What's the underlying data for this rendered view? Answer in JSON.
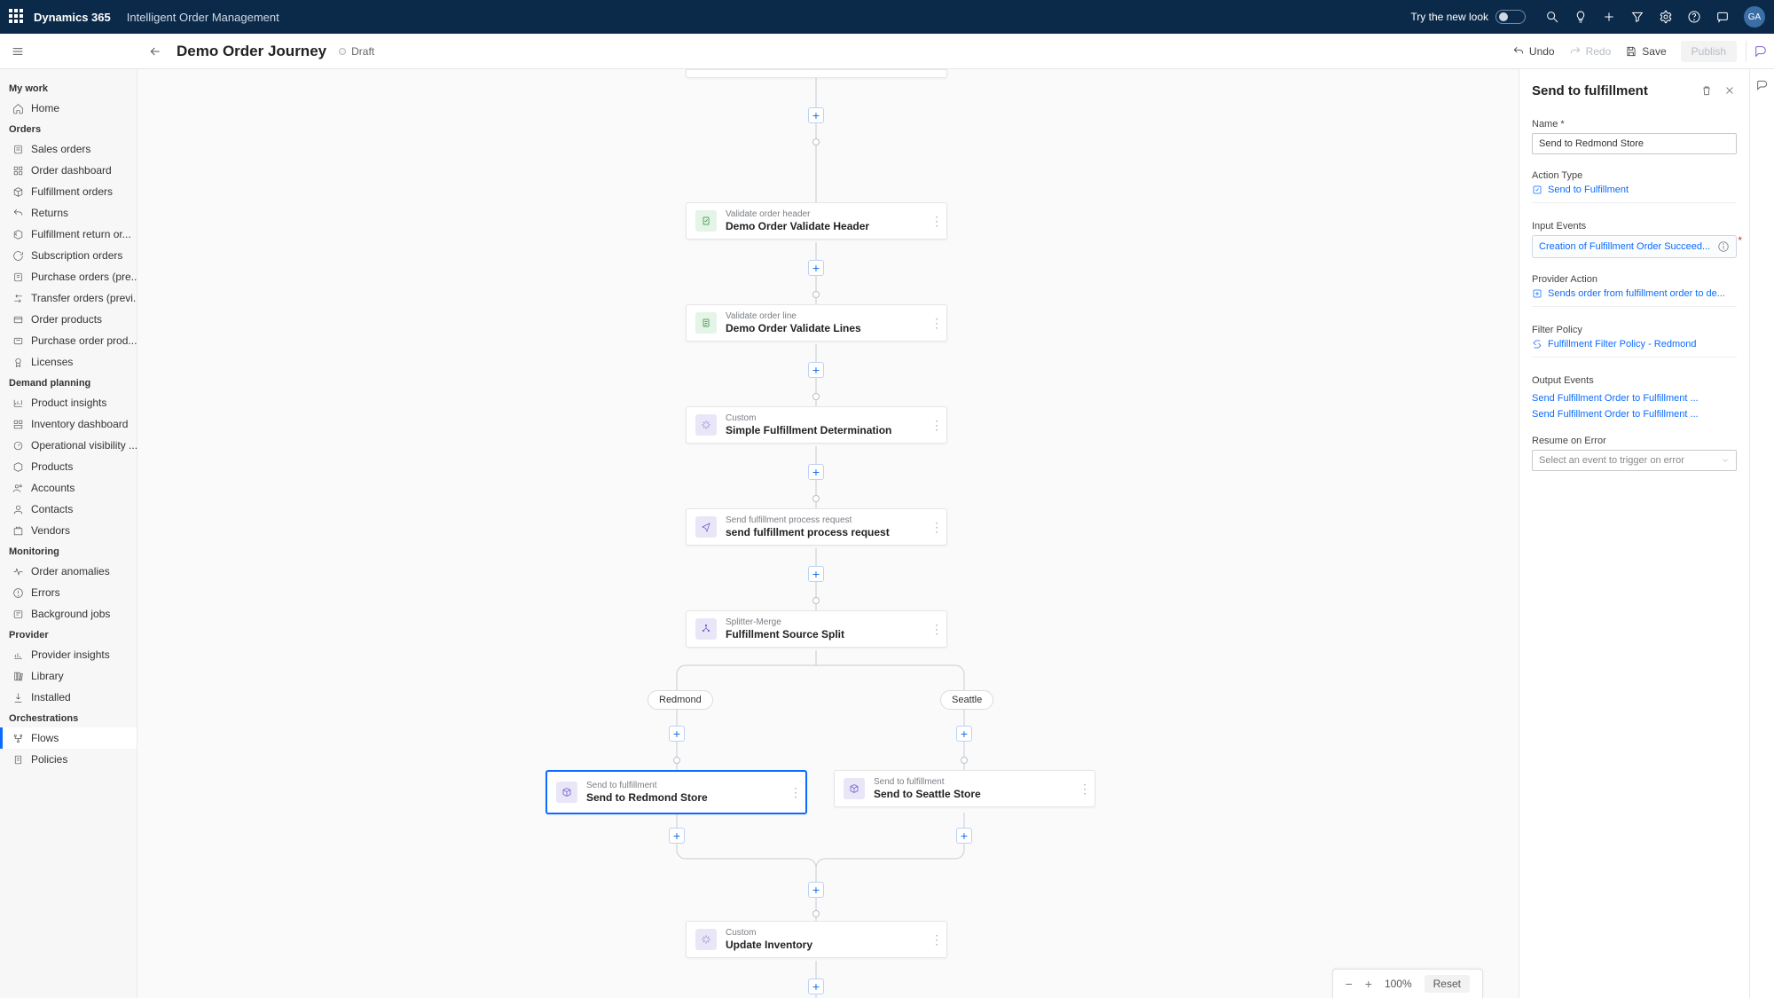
{
  "topbar": {
    "product": "Dynamics 365",
    "module": "Intelligent Order Management",
    "try_label": "Try the new look",
    "avatar_initials": "GA"
  },
  "cmdbar": {
    "page_title": "Demo Order Journey",
    "status": "Draft",
    "undo": "Undo",
    "redo": "Redo",
    "save": "Save",
    "publish": "Publish"
  },
  "nav": {
    "g_mywork": "My work",
    "home": "Home",
    "g_orders": "Orders",
    "sales_orders": "Sales orders",
    "order_dashboard": "Order dashboard",
    "fulfillment_orders": "Fulfillment orders",
    "returns": "Returns",
    "fulfillment_return": "Fulfillment return or...",
    "subscription_orders": "Subscription orders",
    "purchase_orders_pre": "Purchase orders (pre...",
    "transfer_orders": "Transfer orders (previ...",
    "order_products": "Order products",
    "purchase_order_prod": "Purchase order prod...",
    "licenses": "Licenses",
    "g_demand": "Demand planning",
    "product_insights": "Product insights",
    "inventory_dashboard": "Inventory dashboard",
    "operational_visibility": "Operational visibility ...",
    "products": "Products",
    "accounts": "Accounts",
    "contacts": "Contacts",
    "vendors": "Vendors",
    "g_monitoring": "Monitoring",
    "order_anomalies": "Order anomalies",
    "errors": "Errors",
    "background_jobs": "Background jobs",
    "g_provider": "Provider",
    "provider_insights": "Provider insights",
    "library": "Library",
    "installed": "Installed",
    "g_orchestrations": "Orchestrations",
    "flows": "Flows",
    "policies": "Policies"
  },
  "nodes": {
    "n1_type": "Validate order header",
    "n1_title": "Demo Order Validate Header",
    "n2_type": "Validate order line",
    "n2_title": "Demo Order Validate Lines",
    "n3_type": "Custom",
    "n3_title": "Simple Fulfillment Determination",
    "n4_type": "Send fulfillment process request",
    "n4_title": "send fulfillment process request",
    "n5_type": "Splitter-Merge",
    "n5_title": "Fulfillment Source Split",
    "branch_redmond": "Redmond",
    "branch_seattle": "Seattle",
    "n6_type": "Send to fulfillment",
    "n6_title": "Send to Redmond Store",
    "n7_type": "Send to fulfillment",
    "n7_title": "Send to Seattle Store",
    "n8_type": "Custom",
    "n8_title": "Update Inventory"
  },
  "zoom": {
    "level": "100%",
    "reset": "Reset"
  },
  "props": {
    "header": "Send to fulfillment",
    "name_label": "Name *",
    "name_value": "Send to Redmond Store",
    "action_type_label": "Action Type",
    "action_type_value": "Send to Fulfillment",
    "input_events_label": "Input Events",
    "input_event_chip": "Creation of Fulfillment Order Succeed...",
    "provider_action_label": "Provider Action",
    "provider_action_value": "Sends order from fulfillment order to de...",
    "filter_policy_label": "Filter Policy",
    "filter_policy_value": "Fulfillment Filter Policy - Redmond",
    "output_events_label": "Output Events",
    "output_event_1": "Send Fulfillment Order to Fulfillment ...",
    "output_event_2": "Send Fulfillment Order to Fulfillment ...",
    "resume_label": "Resume on Error",
    "resume_placeholder": "Select an event to trigger on error"
  }
}
